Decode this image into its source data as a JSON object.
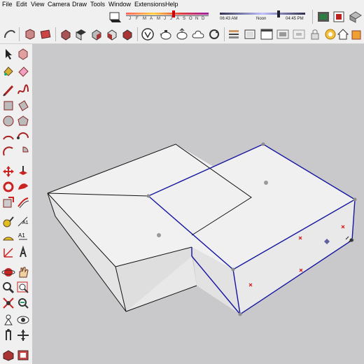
{
  "menu": [
    "File",
    "Edit",
    "View",
    "Camera",
    "Draw",
    "Tools",
    "Window",
    "Extensions",
    "Help"
  ],
  "shadow_settings": {
    "months": [
      "J",
      "F",
      "M",
      "A",
      "M",
      "J",
      "J",
      "A",
      "S",
      "O",
      "N",
      "D"
    ],
    "time_start": "06:43 AM",
    "time_mid": "Noon",
    "time_end": "04:45 PM"
  },
  "colors": {
    "selection_blue": "#1414a0",
    "face_light": "#f2f2f2",
    "face_side": "#e6e6e6",
    "viewport_bg": "#c9c9cc",
    "endpoint_gray": "#999999",
    "marker_red": "#d01010",
    "marker_purple": "#6060a0"
  },
  "model": {
    "description_text": "",
    "selected_object": "L-shaped solid top face group"
  }
}
